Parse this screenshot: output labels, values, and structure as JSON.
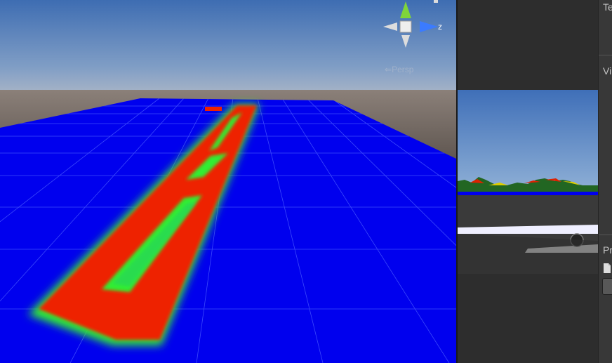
{
  "scene_view": {
    "gizmo": {
      "axis_z_label": "z",
      "projection_label": "Persp"
    }
  },
  "inspector": {
    "sections": [
      "Te",
      "Vi",
      "Pr"
    ]
  },
  "colors": {
    "sky_top": "#3e6db2",
    "sky_horizon": "#a9b5c7",
    "ground": "#6e6660",
    "plane": "#0000ee",
    "heat_high": "#ee2200",
    "heat_mid": "#22ee00",
    "panel_bg": "#383838"
  }
}
